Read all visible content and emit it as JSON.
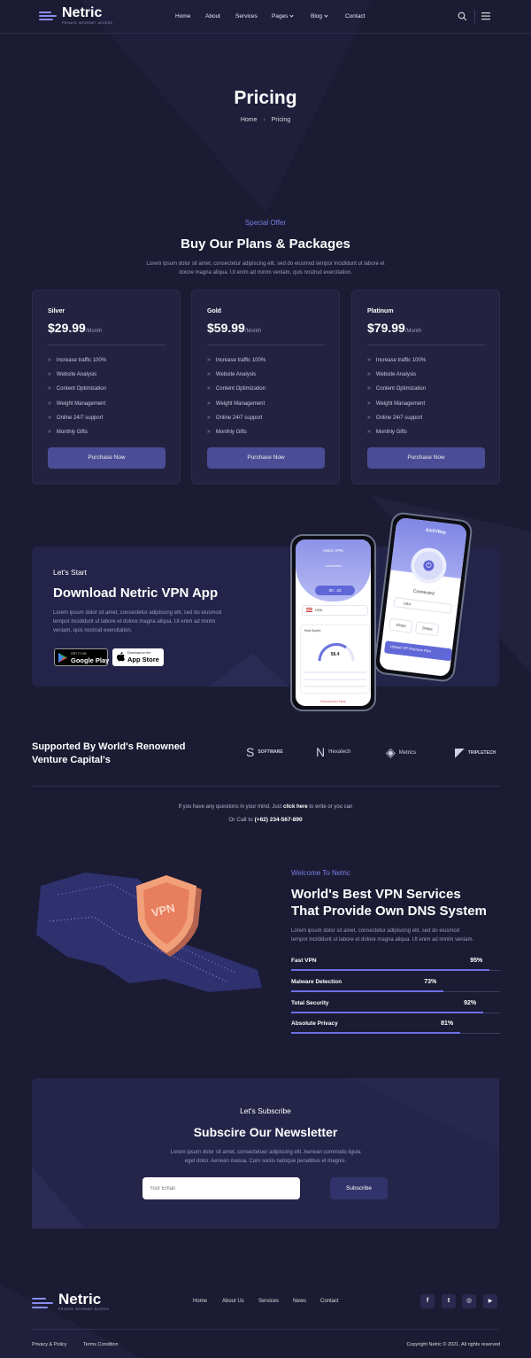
{
  "brand": {
    "name": "Netric",
    "tagline": "private internet access"
  },
  "nav": {
    "items": [
      "Home",
      "About",
      "Services",
      "Pages",
      "Blog",
      "Contact"
    ]
  },
  "hero": {
    "title": "Pricing",
    "breadcrumb_home": "Home",
    "breadcrumb_sep": "›",
    "breadcrumb_current": "Pricing"
  },
  "pricing": {
    "tag": "Special Offer",
    "title": "Buy Our Plans & Packages",
    "desc_line1": "Lorem ipsum dolor sit amet, consectetur adipiscing elit, sed do eiusmod tempor incididunt ut labore et",
    "desc_line2": "dolore magna aliqua. Ut enim ad minim veniam, quis nostrud exercitation.",
    "plans": [
      {
        "name": "Silver",
        "price": "$29.99",
        "period": "/Month"
      },
      {
        "name": "Gold",
        "price": "$59.99",
        "period": "/Month"
      },
      {
        "name": "Platinum",
        "price": "$79.99",
        "period": "/Month"
      }
    ],
    "features": [
      "Increase traffic 100%",
      "Website Analysis",
      "Content Optimization",
      "Weight Management",
      "Online 24/7 support",
      "Monthly Gifts"
    ],
    "button": "Purchase Now"
  },
  "app": {
    "tag": "Let's Start",
    "title": "Download Netric VPN App",
    "desc_line1": "Lorem ipsum dolor sit amet, consectetur adipiscing elit, sed do eiusmod",
    "desc_line2": "tempor incididunt ut labore et dolore magna aliqua. Ut enim ad minim",
    "desc_line3": "veniam, quis nostrud exercitation.",
    "google_small": "GET IT ON",
    "google_big": "Google Play",
    "apple_small": "Download on the",
    "apple_big": "App Store",
    "phone1": {
      "header": "Netric VPN",
      "status": "connected",
      "timer": "00 : 43",
      "country": "USA",
      "speed_label": "Real Speed",
      "speed_value": "58.4",
      "disconnect": "Disconnect Now"
    },
    "phone2": {
      "brand": "EASYBay",
      "status": "Connected",
      "country": "USA",
      "stat1": "1Gbps",
      "stat2": "2mbps",
      "banner": "Upload VIP Premium Plan"
    }
  },
  "partners": {
    "title_line1": "Supported By World's Renowned",
    "title_line2": "Venture Capital's",
    "logos": [
      {
        "name": "SOFTWARE",
        "icon": "S"
      },
      {
        "name": "Hexatech",
        "icon": "N"
      },
      {
        "name": "Metrics",
        "icon": "◈"
      },
      {
        "name": "TRIPLETECH",
        "icon": "◤"
      }
    ]
  },
  "contact": {
    "line1_pre": "If you have any questions in your mind, Just ",
    "line1_link": "click here",
    "line1_post": " to write or you can",
    "line2_pre": "Or Call to ",
    "phone": "(+62) 234-567-890"
  },
  "about": {
    "tag": "Welcome To Netric",
    "title_line1": "World's Best VPN Services",
    "title_line2": "That Provide Own DNS System",
    "desc_line1": "Lorem ipsum dolor sit amet, consectetur adipiscing elit, sed do eiusmod",
    "desc_line2": "tempor incididunt ut labore et dolore magna aliqua. Ut enim ad minim veniam.",
    "badge": "VPN",
    "skills": [
      {
        "label": "Fast VPN",
        "value": 95,
        "text": "95%"
      },
      {
        "label": "Malware Detection",
        "value": 73,
        "text": "73%"
      },
      {
        "label": "Total Security",
        "value": 92,
        "text": "92%"
      },
      {
        "label": "Absolute Privacy",
        "value": 81,
        "text": "81%"
      }
    ]
  },
  "newsletter": {
    "tag": "Let's Subscribe",
    "title": "Subscire Our Newsletter",
    "desc_line1": "Lorem ipsum dolor sit amet, consectetuer adipiscing elit. Aenean commodo ligula",
    "desc_line2": "eget dolor. Aenean massa. Cum sociis natoque penatibus et magnis.",
    "placeholder": "Your Email",
    "button": "Subscribe"
  },
  "footer": {
    "links": [
      "Home",
      "About Us",
      "Services",
      "News",
      "Contact"
    ],
    "social": [
      {
        "icon": "facebook-icon",
        "glyph": "f"
      },
      {
        "icon": "twitter-icon",
        "glyph": "t"
      },
      {
        "icon": "instagram-icon",
        "glyph": "◎"
      },
      {
        "icon": "youtube-icon",
        "glyph": "▶"
      }
    ],
    "privacy": "Privacy & Policy",
    "terms": "Terms Condition",
    "copyright": "Copyright Netric © 2021. All rights reserved"
  },
  "colors": {
    "bg": "#1b1b33",
    "accent": "#7b7fe6",
    "button": "#4a4d95"
  }
}
